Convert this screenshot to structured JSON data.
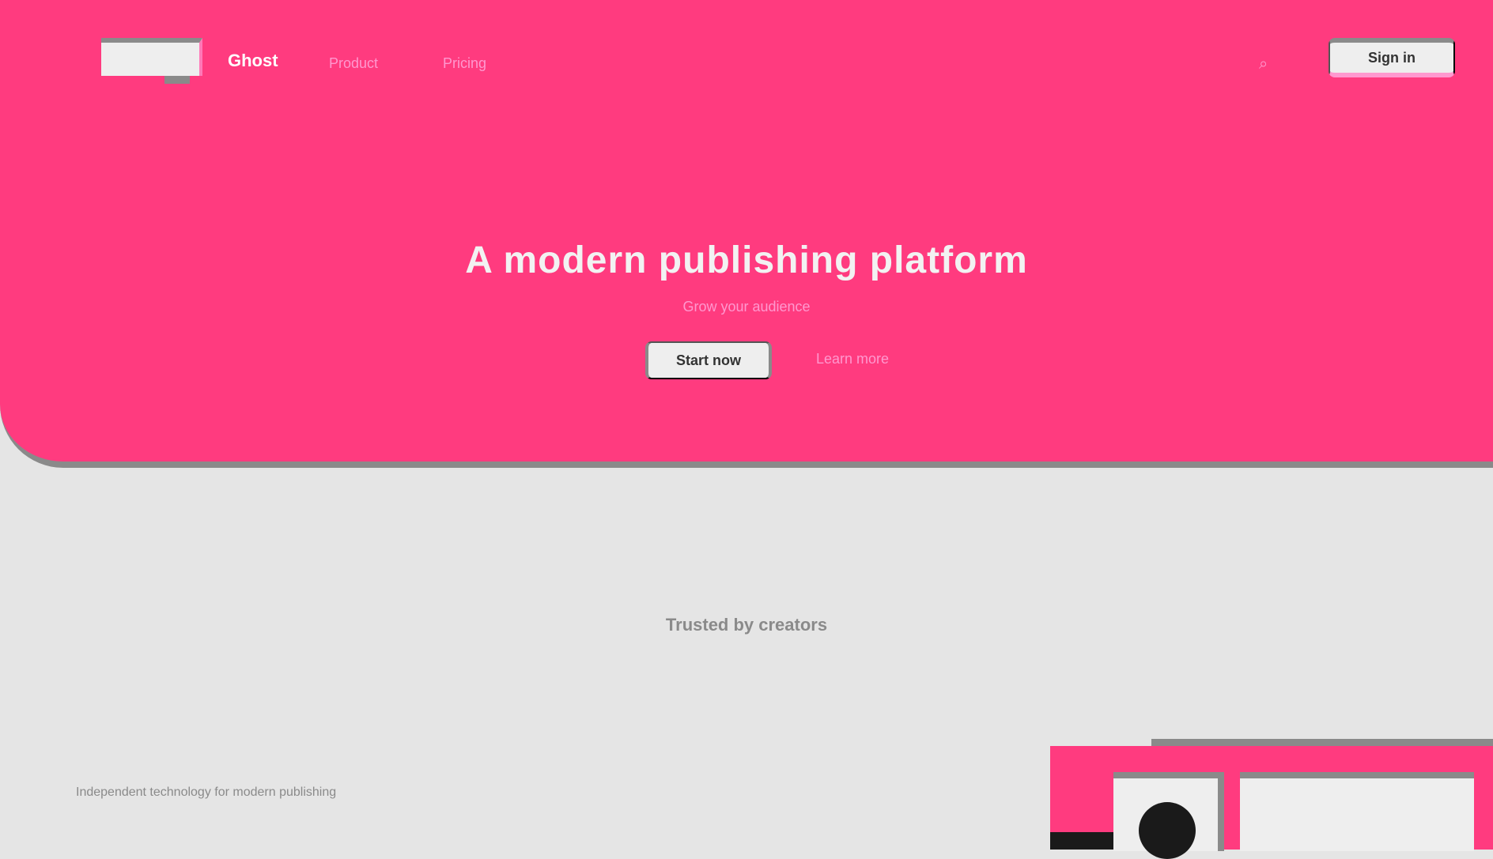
{
  "nav": {
    "brand": "Ghost",
    "links": [
      "Product",
      "Pricing"
    ],
    "search_icon": "search-icon",
    "signin_label": "Sign in"
  },
  "hero": {
    "title": "A modern publishing platform",
    "subtitle": "Grow your audience",
    "cta_primary": "Start now",
    "cta_secondary": "Learn more"
  },
  "section": {
    "heading": "Trusted by creators"
  },
  "footer": {
    "note": "Independent technology for modern publishing"
  },
  "colors": {
    "accent": "#ff3b7f",
    "background": "#e5e5e5",
    "muted": "#8a8a8a"
  }
}
